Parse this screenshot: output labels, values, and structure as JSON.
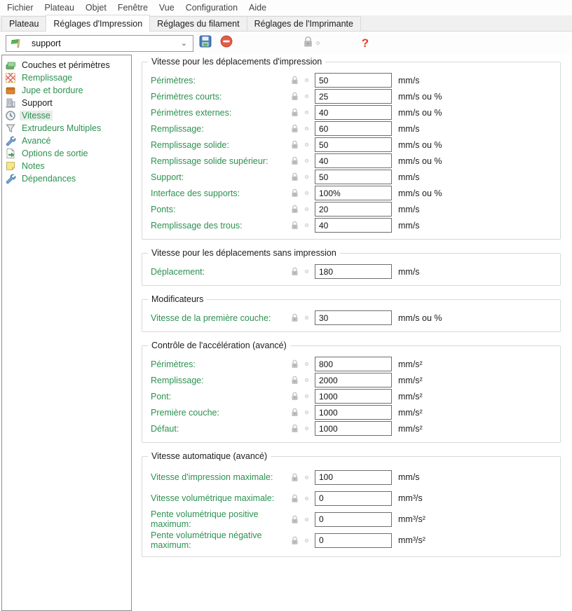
{
  "menu_bar": {
    "items": [
      {
        "label": "Fichier"
      },
      {
        "label": "Plateau"
      },
      {
        "label": "Objet"
      },
      {
        "label": "Fenêtre"
      },
      {
        "label": "Vue"
      },
      {
        "label": "Configuration"
      },
      {
        "label": "Aide"
      }
    ]
  },
  "tab_bar": {
    "tabs": [
      {
        "label": "Plateau",
        "active": false
      },
      {
        "label": "Réglages d'Impression",
        "active": true
      },
      {
        "label": "Réglages du filament",
        "active": false
      },
      {
        "label": "Réglages de l'Imprimante",
        "active": false
      }
    ]
  },
  "toolbar": {
    "preset_selector": {
      "value": "support",
      "icon": "flag-icon"
    },
    "save_icon": "save-icon",
    "delete_icon": "delete-icon",
    "lock_icon": "lock-icon",
    "help_label": "?"
  },
  "colors": {
    "label_green": "#2c9150",
    "help_red": "#e8402a"
  },
  "sidebar": {
    "items": [
      {
        "label": "Couches et périmètres",
        "icon": "layers-icon",
        "modified": true,
        "selected": false
      },
      {
        "label": "Remplissage",
        "icon": "infill-icon",
        "modified": false,
        "selected": false
      },
      {
        "label": "Jupe et bordure",
        "icon": "skirt-icon",
        "modified": false,
        "selected": false
      },
      {
        "label": "Support",
        "icon": "support-icon",
        "modified": true,
        "selected": false
      },
      {
        "label": "Vitesse",
        "icon": "speed-icon",
        "modified": false,
        "selected": true
      },
      {
        "label": "Extrudeurs Multiples",
        "icon": "extruders-icon",
        "modified": false,
        "selected": false
      },
      {
        "label": "Avancé",
        "icon": "wrench-icon",
        "modified": false,
        "selected": false
      },
      {
        "label": "Options de sortie",
        "icon": "output-icon",
        "modified": false,
        "selected": false
      },
      {
        "label": "Notes",
        "icon": "notes-icon",
        "modified": false,
        "selected": false
      },
      {
        "label": "Dépendances",
        "icon": "wrench-icon",
        "modified": false,
        "selected": false
      }
    ]
  },
  "sections": [
    {
      "title": "Vitesse pour les déplacements d'impression",
      "wide": false,
      "rows": [
        {
          "label": "Périmètres:",
          "value": "50",
          "unit": "mm/s"
        },
        {
          "label": "Périmètres courts:",
          "value": "25",
          "unit": "mm/s ou %"
        },
        {
          "label": "Périmètres externes:",
          "value": "40",
          "unit": "mm/s ou %"
        },
        {
          "label": "Remplissage:",
          "value": "60",
          "unit": "mm/s"
        },
        {
          "label": "Remplissage solide:",
          "value": "50",
          "unit": "mm/s ou %"
        },
        {
          "label": "Remplissage solide supérieur:",
          "value": "40",
          "unit": "mm/s ou %"
        },
        {
          "label": "Support:",
          "value": "50",
          "unit": "mm/s"
        },
        {
          "label": "Interface des supports:",
          "value": "100%",
          "unit": "mm/s ou %"
        },
        {
          "label": "Ponts:",
          "value": "20",
          "unit": "mm/s"
        },
        {
          "label": "Remplissage des trous:",
          "value": "40",
          "unit": "mm/s"
        }
      ]
    },
    {
      "title": "Vitesse pour les déplacements sans impression",
      "wide": false,
      "rows": [
        {
          "label": "Déplacement:",
          "value": "180",
          "unit": "mm/s"
        }
      ]
    },
    {
      "title": "Modificateurs",
      "wide": false,
      "rows": [
        {
          "label": "Vitesse de la première couche:",
          "value": "30",
          "unit": "mm/s ou %"
        }
      ]
    },
    {
      "title": "Contrôle de l'accélération (avancé)",
      "wide": false,
      "rows": [
        {
          "label": "Périmètres:",
          "value": "800",
          "unit": "mm/s²"
        },
        {
          "label": "Remplissage:",
          "value": "2000",
          "unit": "mm/s²"
        },
        {
          "label": "Pont:",
          "value": "1000",
          "unit": "mm/s²"
        },
        {
          "label": "Première couche:",
          "value": "1000",
          "unit": "mm/s²"
        },
        {
          "label": "Défaut:",
          "value": "1000",
          "unit": "mm/s²"
        }
      ]
    },
    {
      "title": "Vitesse automatique (avancé)",
      "wide": true,
      "rows": [
        {
          "label": "Vitesse d'impression maximale:",
          "value": "100",
          "unit": "mm/s"
        },
        {
          "label": "Vitesse volumétrique maximale:",
          "value": "0",
          "unit": "mm³/s"
        },
        {
          "label": "Pente volumétrique positive maximum:",
          "value": "0",
          "unit": "mm³/s²"
        },
        {
          "label": "Pente volumétrique négative maximum:",
          "value": "0",
          "unit": "mm³/s²"
        }
      ]
    }
  ]
}
